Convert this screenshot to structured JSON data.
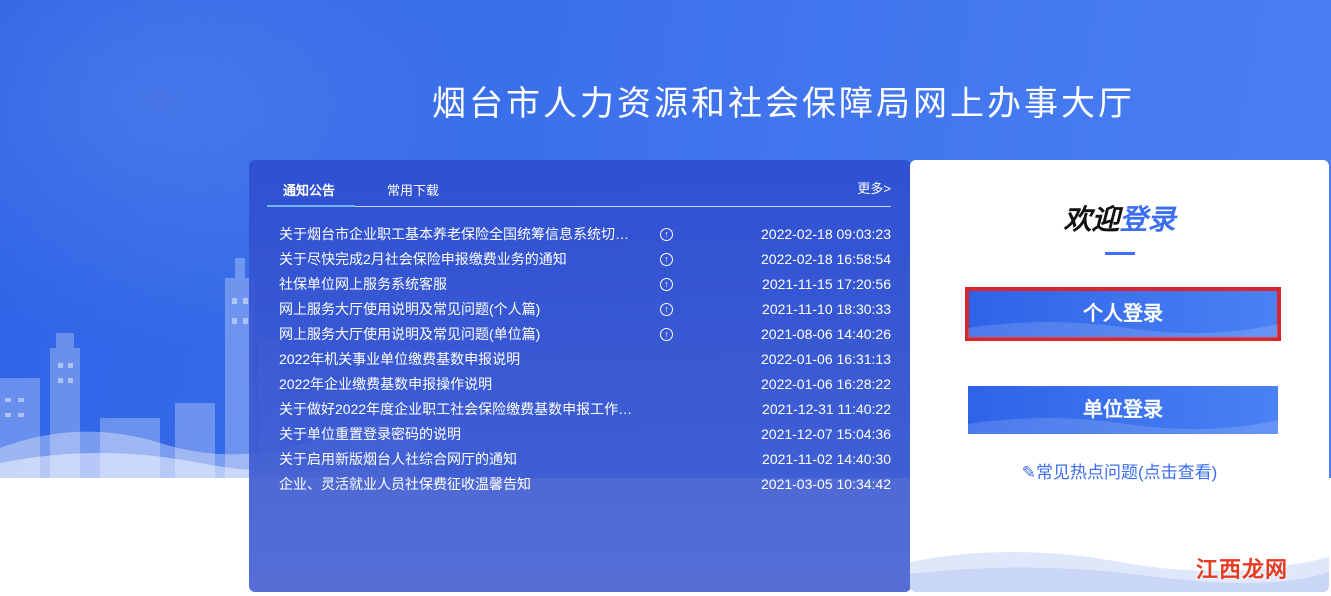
{
  "page_title": "烟台市人力资源和社会保障局网上办事大厅",
  "notice_panel": {
    "tabs": [
      {
        "label": "通知公告",
        "active": true
      },
      {
        "label": "常用下载",
        "active": false
      }
    ],
    "more_label": "更多>",
    "items": [
      {
        "title": "关于烟台市企业职工基本养老保险全国统筹信息系统切…",
        "date": "2022-02-18 09:03:23",
        "pinned": true
      },
      {
        "title": "关于尽快完成2月社会保险申报缴费业务的通知",
        "date": "2022-02-18 16:58:54",
        "pinned": true
      },
      {
        "title": "社保单位网上服务系统客服",
        "date": "2021-11-15 17:20:56",
        "pinned": true
      },
      {
        "title": "网上服务大厅使用说明及常见问题(个人篇)",
        "date": "2021-11-10 18:30:33",
        "pinned": true
      },
      {
        "title": "网上服务大厅使用说明及常见问题(单位篇)",
        "date": "2021-08-06 14:40:26",
        "pinned": true
      },
      {
        "title": "2022年机关事业单位缴费基数申报说明",
        "date": "2022-01-06 16:31:13",
        "pinned": false
      },
      {
        "title": "2022年企业缴费基数申报操作说明",
        "date": "2022-01-06 16:28:22",
        "pinned": false
      },
      {
        "title": "关于做好2022年度企业职工社会保险缴费基数申报工作…",
        "date": "2021-12-31 11:40:22",
        "pinned": false
      },
      {
        "title": "关于单位重置登录密码的说明",
        "date": "2021-12-07 15:04:36",
        "pinned": false
      },
      {
        "title": "关于启用新版烟台人社综合网厅的通知",
        "date": "2021-11-02 14:40:30",
        "pinned": false
      },
      {
        "title": "企业、灵活就业人员社保费征收温馨告知",
        "date": "2021-03-05 10:34:42",
        "pinned": false
      }
    ]
  },
  "login_panel": {
    "welcome_part1": "欢迎",
    "welcome_part2": "登录",
    "personal_login": "个人登录",
    "unit_login": "单位登录",
    "faq_label": "常见热点问题(点击查看)"
  },
  "watermark": {
    "part1": "江",
    "part2": "西",
    "part3": "龙网"
  },
  "colors": {
    "accent": "#3b6ef0",
    "hero": "#2d63e6",
    "highlight": "#d8262e"
  }
}
